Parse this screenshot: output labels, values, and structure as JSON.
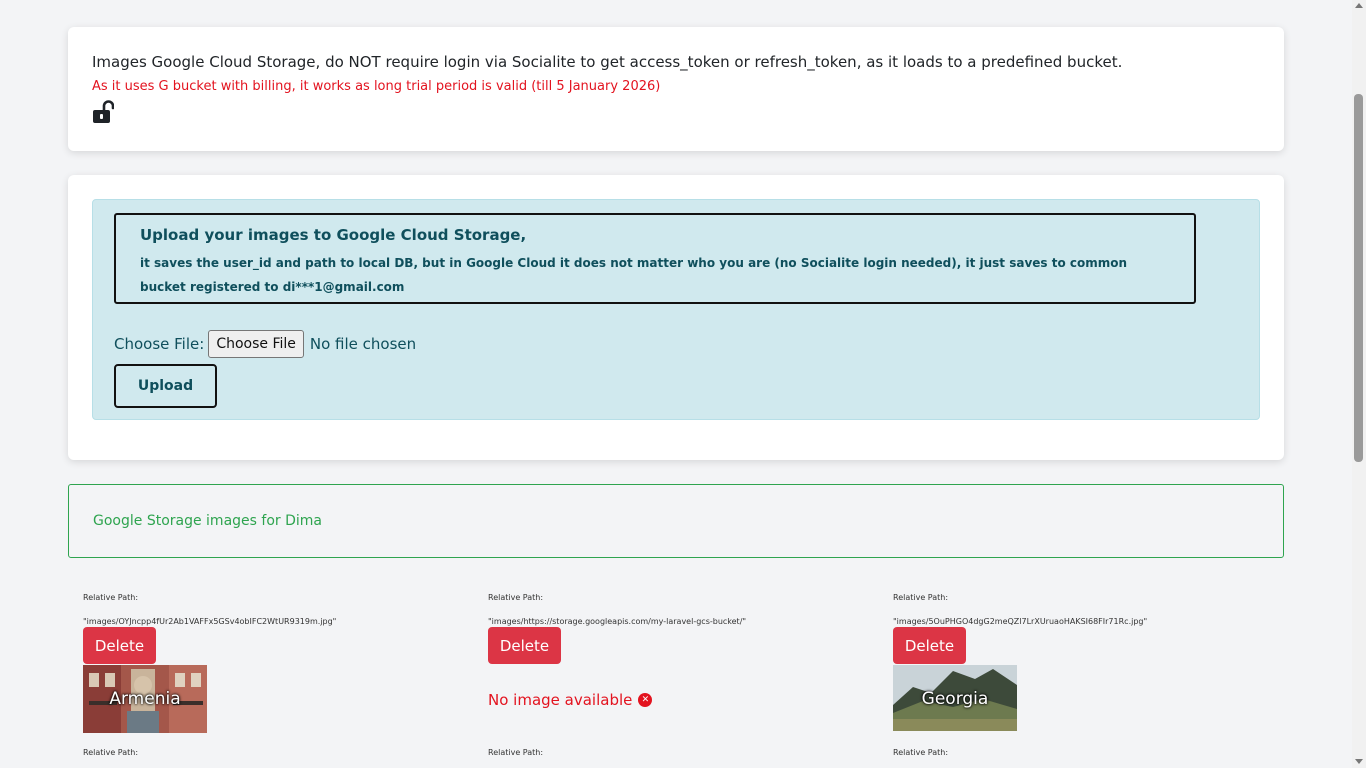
{
  "info": {
    "title": "Images Google Cloud Storage, do NOT require login via Socialite to get access_token or refresh_token, as it loads to a predefined bucket.",
    "warning": "As it uses G bucket with billing, it works as long trial period is valid (till 5 January 2026)",
    "icon": "unlock-icon"
  },
  "upload": {
    "notice_title": "Upload your images to Google Cloud Storage,",
    "notice_body": "it saves the user_id and path to local DB, but in Google Cloud it does not matter who you are (no Socialite login needed), it just saves to common bucket registered to di***1@gmail.com",
    "choose_file_label": "Choose File:",
    "choose_file_button": "Choose File",
    "no_file_text": "No file chosen",
    "upload_button": "Upload"
  },
  "success": {
    "message": "Google Storage images for Dima"
  },
  "images": [
    {
      "label": "Relative Path:",
      "path": "\"images/OYJncpp4fUr2Ab1VAFFx5GSv4obIFC2WtUR9319m.jpg\"",
      "delete_label": "Delete",
      "thumb_caption": "Armenia"
    },
    {
      "label": "Relative Path:",
      "path": "\"images/https://storage.googleapis.com/my-laravel-gcs-bucket/\"",
      "delete_label": "Delete",
      "no_image_text": "No image available",
      "no_image_icon": "x-circle-icon"
    },
    {
      "label": "Relative Path:",
      "path": "\"images/5OuPHGO4dgG2meQZl7LrXUruaoHAKSI68FIr71Rc.jpg\"",
      "delete_label": "Delete",
      "thumb_caption": "Georgia"
    }
  ],
  "next_row": [
    {
      "label": "Relative Path:"
    },
    {
      "label": "Relative Path:"
    },
    {
      "label": "Relative Path:"
    }
  ],
  "colors": {
    "accent_danger": "#dc3545",
    "success": "#2ea44f",
    "warning_text": "#e3131f",
    "panel_bg": "#d0e9ee"
  }
}
